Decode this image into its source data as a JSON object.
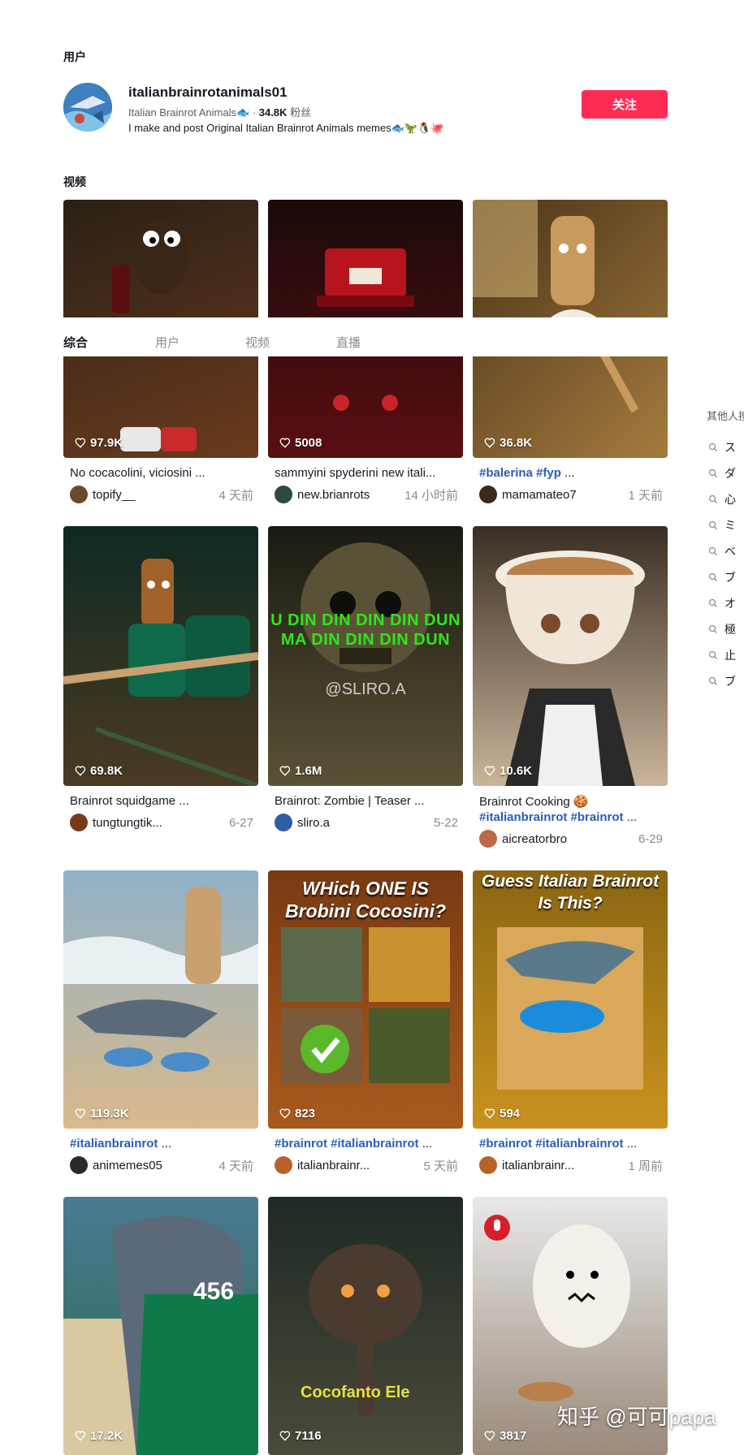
{
  "sections": {
    "users": "用户",
    "videos": "视频"
  },
  "user": {
    "name": "italianbrainrotanimals01",
    "nickname": "Italian Brainrot Animals🐟",
    "separator": "·",
    "followers": "34.8K",
    "followers_label": "粉丝",
    "bio": "I make and post Original Italian Brainrot Animals memes🐟🦖🐧🐙",
    "follow_label": "关注"
  },
  "tabs": [
    {
      "label": "综合",
      "active": true
    },
    {
      "label": "用户",
      "active": false
    },
    {
      "label": "视频",
      "active": false
    },
    {
      "label": "直播",
      "active": false
    }
  ],
  "sidebar": {
    "title": "其他人搜",
    "items": [
      "ス",
      "ダ",
      "心",
      "ミ",
      "ベ",
      "ブ",
      "オ",
      "極",
      "止",
      "ブ"
    ]
  },
  "videos": [
    {
      "likes": "97.9K",
      "title": "No cocacolini, viciosini ...",
      "author": "topify__",
      "time": "4 天前",
      "colors": [
        "#2a2016",
        "#6b3b1e"
      ],
      "avatar": "#6b4a2a"
    },
    {
      "likes": "5008",
      "title": "sammyini spyderini new itali...",
      "author": "new.brianrots",
      "time": "14 小时前",
      "colors": [
        "#1a0a0a",
        "#5a0e12"
      ],
      "avatar": "#2e4a3c"
    },
    {
      "likes": "36.8K",
      "title_tags": "#balerina #fyp",
      "title_rest": " ...",
      "author": "mamamateo7",
      "time": "1 天前",
      "colors": [
        "#4a3418",
        "#a57a3f"
      ],
      "avatar": "#3a2a1a"
    },
    {
      "likes": "69.8K",
      "title": "Brainrot squidgame ...",
      "author": "tungtungtik...",
      "time": "6-27",
      "colors": [
        "#0e2a22",
        "#4a3a22"
      ],
      "avatar": "#7a3a1a"
    },
    {
      "likes": "1.6M",
      "title": "Brainrot: Zombie | Teaser ...",
      "author": "sliro.a",
      "time": "5-22",
      "colors": [
        "#1a1a12",
        "#5a5236"
      ],
      "avatar": "#2e5ea8",
      "overlay_text": "U DIN DIN DIN DIN DUN MA DIN DIN DIN DUN",
      "overlay_sub": "@SLIRO.A"
    },
    {
      "likes": "10.6K",
      "title": "Brainrot Cooking 🍪",
      "title2": "#italianbrainrot #brainrot",
      "title2_rest": " ...",
      "author": "aicreatorbro",
      "time": "6-29",
      "colors": [
        "#3a2e24",
        "#c9b49a"
      ],
      "avatar": "#b86a4a"
    },
    {
      "likes": "119.3K",
      "title_tags": "#italianbrainrot",
      "title_rest": " ...",
      "author": "animemes05",
      "time": "4 天前",
      "colors": [
        "#8fb2c9",
        "#d9b98a"
      ],
      "avatar": "#2a2a2a"
    },
    {
      "likes": "823",
      "title_tags": "#brainrot #italianbrainrot",
      "title_rest": " ...",
      "author": "italianbrainr...",
      "time": "5 天前",
      "colors": [
        "#7a3a12",
        "#a85a1e"
      ],
      "avatar": "#b8622a",
      "overlay_text": "WHich ONE IS Brobini Cocosini?"
    },
    {
      "likes": "594",
      "title_tags": "#brainrot #italianbrainrot",
      "title_rest": " ...",
      "author": "italianbrainr...",
      "time": "1 周前",
      "colors": [
        "#8a6612",
        "#c9921e"
      ],
      "avatar": "#b8622a",
      "overlay_text": "Guess Italian Brainrot Is This?"
    },
    {
      "likes": "17.2K",
      "colors": [
        "#4a7a94",
        "#2a6a4a"
      ],
      "overlay_text": "456"
    },
    {
      "likes": "7116",
      "colors": [
        "#1e2a24",
        "#4a4a3a"
      ],
      "overlay_text": "Cocofanto Ele"
    },
    {
      "likes": "3817",
      "colors": [
        "#e8e8e8",
        "#9a8a7a"
      ]
    }
  ],
  "watermark": "知乎 @可可papa"
}
